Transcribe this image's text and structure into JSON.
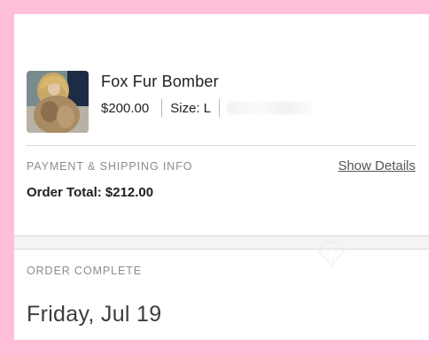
{
  "item": {
    "name": "Fox Fur Bomber",
    "price": "$200.00",
    "size": "Size: L",
    "thumbnail_icon": "product-photo-icon"
  },
  "payment": {
    "section_label": "PAYMENT & SHIPPING INFO",
    "show_details_label": "Show Details",
    "order_total": "Order Total: $212.00"
  },
  "order_status": {
    "section_label": "ORDER COMPLETE",
    "date": "Friday, Jul 19"
  },
  "colors": {
    "frame_pink": "#ffbfd9",
    "card_bg": "#ffffff",
    "text_dark": "#1f1f1f",
    "label_gray": "#8c8c8c"
  }
}
